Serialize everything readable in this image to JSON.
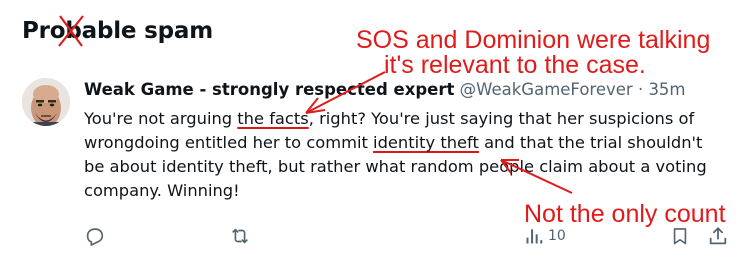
{
  "section": {
    "heading": "Probable spam"
  },
  "tweet": {
    "author_name": "Weak Game - strongly respected expert",
    "handle": "@WeakGameForever",
    "separator": "·",
    "time": "35m",
    "body": {
      "p1": "You're not arguing ",
      "u1": "the facts",
      "p2": ", right?  You're just saying that her suspicions of wrongdoing entitled her to commit ",
      "u2": "identity theft",
      "p3": " and that the trial shouldn't be about identity theft, but rather what random people claim about a voting company.  Winning!"
    },
    "actions": {
      "reply_icon": "reply-icon",
      "retweet_icon": "retweet-icon",
      "views_icon": "views-icon",
      "views_count": "10",
      "bookmark_icon": "bookmark-icon",
      "share_icon": "share-icon"
    }
  },
  "annotations": {
    "top_line1": "SOS and Dominion were talking",
    "top_line2": "it's relevant to the case.",
    "bottom": "Not the only count",
    "color": "#e01b1b"
  },
  "colors": {
    "text": "#0f1419",
    "muted": "#536471",
    "annotation_red": "#e01b1b"
  }
}
